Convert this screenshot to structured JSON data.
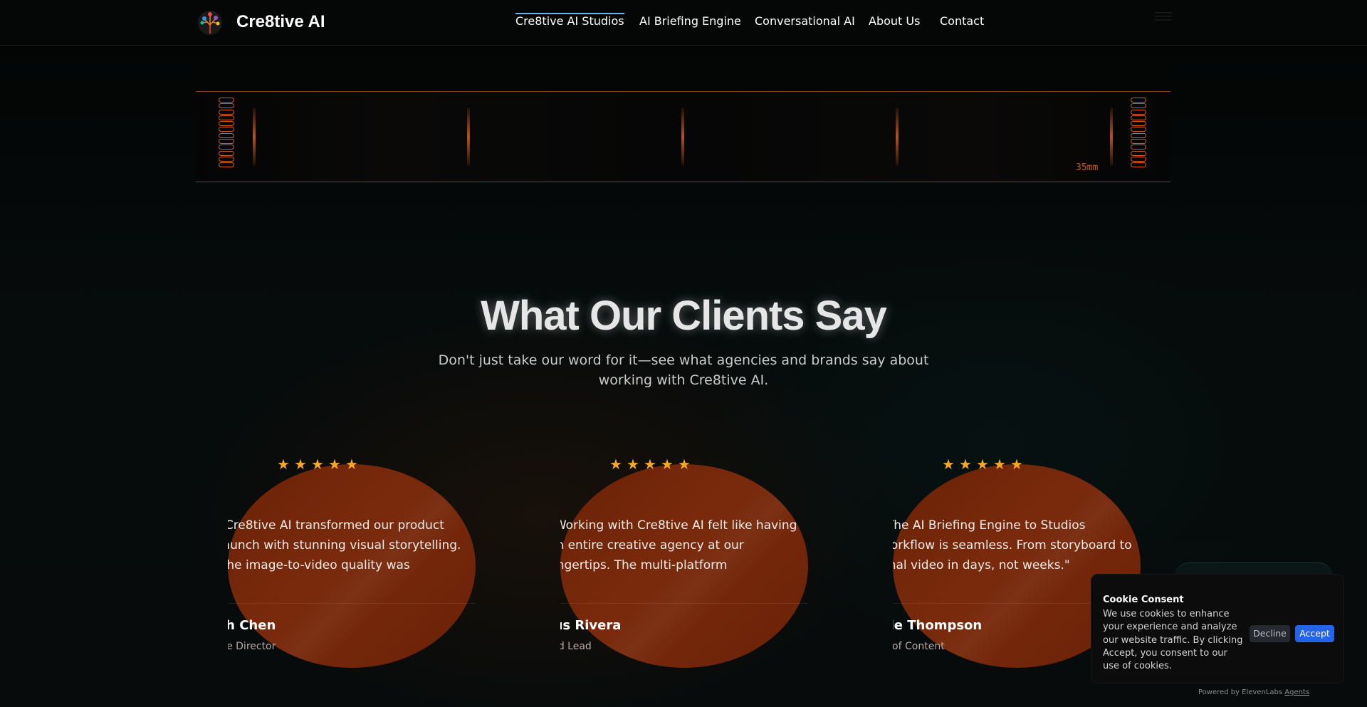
{
  "header": {
    "brand": "Cre8tive AI",
    "nav": [
      {
        "label": "Cre8tive AI Studios",
        "active": true
      },
      {
        "label": "AI Briefing Engine",
        "active": false
      },
      {
        "label": "Conversational AI",
        "active": false
      },
      {
        "label": "About Us",
        "active": false
      },
      {
        "label": "Contact",
        "active": false
      }
    ]
  },
  "film_strip": {
    "label": "35mm"
  },
  "testimonials": {
    "title": "What Our Clients Say",
    "subtitle": "Don't just take our word for it—see what agencies and brands say about working with Cre8tive AI.",
    "rating_glyph": "★",
    "cards": [
      {
        "quote": "\"Cre8tive AI transformed our product launch with stunning visual storytelling. The image-to-video quality was exceptional.\"",
        "name": "Sarah Chen",
        "role": "Creative Director",
        "rating": 5
      },
      {
        "quote": "\"Working with Cre8tive AI felt like having an entire creative agency at our fingertips. The multi-platform optimization saved us weeks.\"",
        "name": "Marcus Rivera",
        "role": "Brand Lead",
        "rating": 5
      },
      {
        "quote": "\"The AI Briefing Engine to Studios workflow is seamless. From storyboard to final video in days, not weeks.\"",
        "name": "Jamie Thompson",
        "role": "Head of Content",
        "rating": 5
      }
    ]
  },
  "cookie": {
    "title": "Cookie Consent",
    "body": "We use cookies to enhance your experience and analyze our website traffic. By clicking Accept, you consent to our use of cookies.",
    "decline": "Decline",
    "accept": "Accept"
  },
  "footer_badge": {
    "prefix": "Powered by ElevenLabs",
    "link": "Agents"
  },
  "colors": {
    "accent": "#2563eb",
    "film": "#d0601c",
    "star": "#f5a623",
    "card": "#6b2206"
  }
}
